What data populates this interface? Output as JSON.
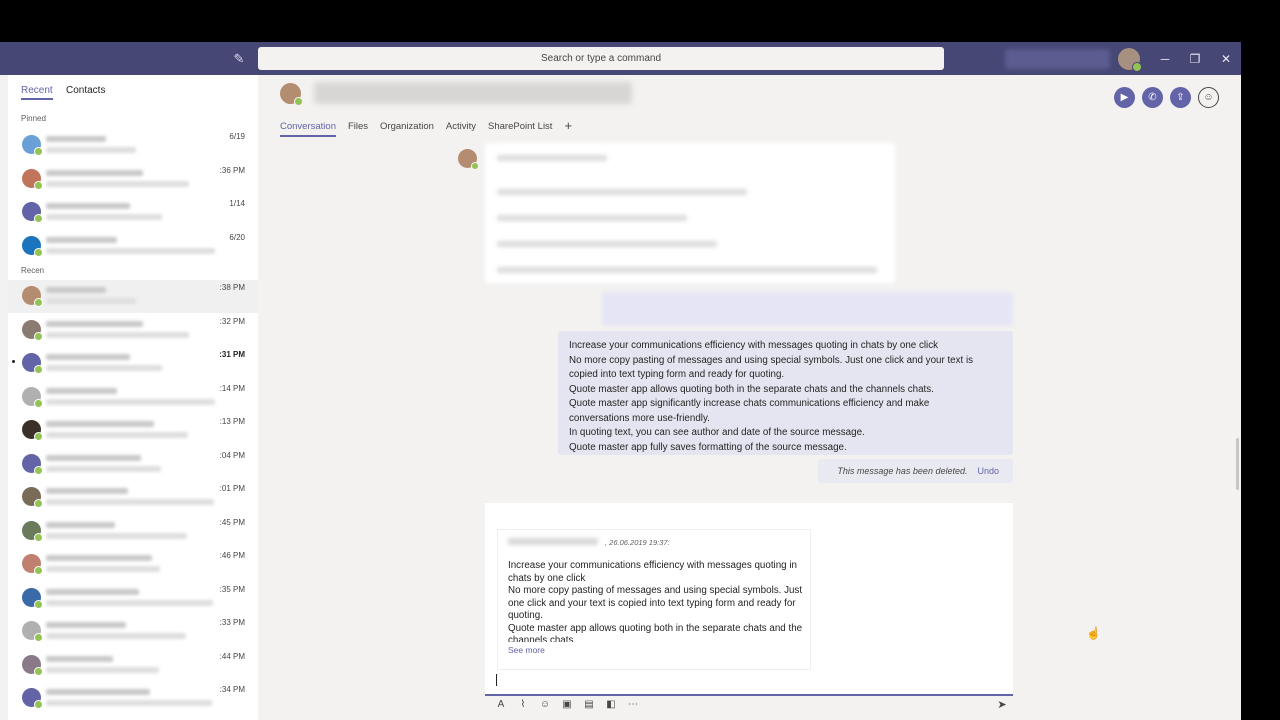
{
  "titlebar": {
    "search_placeholder": "Search or type a command",
    "minimize": "─",
    "restore": "❐",
    "close": "✕"
  },
  "left": {
    "tabs": [
      "Recent",
      "Contacts"
    ],
    "pinned_label": "Pinned",
    "recent_label": "Recen",
    "pinned": [
      {
        "time": "6/19",
        "color": "#6a9fd8"
      },
      {
        "time": ":36 PM",
        "color": "#c0745a"
      },
      {
        "time": "1/14",
        "color": "#6264a7"
      },
      {
        "time": "6/20",
        "color": "#1c75bc"
      }
    ],
    "recent": [
      {
        "time": ":38 PM",
        "color": "#b48c70"
      },
      {
        "time": ":32 PM",
        "color": "#8a7a70"
      },
      {
        "time": ":31 PM",
        "color": "#6264a7"
      },
      {
        "time": ":14 PM",
        "color": "#b0b0b0"
      },
      {
        "time": ":13 PM",
        "color": "#3b2f2a"
      },
      {
        "time": ":04 PM",
        "color": "#6264a7"
      },
      {
        "time": ":01 PM",
        "color": "#7a6a58"
      },
      {
        "time": ":45 PM",
        "color": "#6a7a5a"
      },
      {
        "time": ":46 PM",
        "color": "#c08070"
      },
      {
        "time": ":35 PM",
        "color": "#3a6aa8"
      },
      {
        "time": ":33 PM",
        "color": "#b0b0b0"
      },
      {
        "time": ":44 PM",
        "color": "#8a7a88"
      },
      {
        "time": ":34 PM",
        "color": "#6264a7"
      }
    ]
  },
  "main": {
    "tabs": [
      "Conversation",
      "Files",
      "Organization",
      "Activity",
      "SharePoint List"
    ],
    "add_tab": "+",
    "message_lines": [
      "Increase your communications efficiency with messages quoting in chats by one click",
      "No more copy pasting of messages and using special symbols. Just one click and your text is copied into text typing form and ready for quoting.",
      "Quote master app allows quoting both in the separate chats and the channels chats.",
      "Quote master app significantly increase chats communications efficiency and make conversations more use-friendly.",
      "In quoting text, you can see author and date of the source message.",
      "Quote master app fully saves formatting of the source message."
    ],
    "deleted_text": "This message has been deleted.",
    "undo_label": "Undo"
  },
  "composer": {
    "quote_date": ", 26.06.2019 19:37:",
    "quote_lines": [
      "Increase your communications efficiency with messages quoting in chats by one click",
      "No more copy pasting of messages and using special symbols. Just one click and your text is copied into text typing form and ready for quoting.",
      "Quote master app allows quoting both in the separate chats and the channels chats."
    ],
    "see_more": "See more"
  }
}
